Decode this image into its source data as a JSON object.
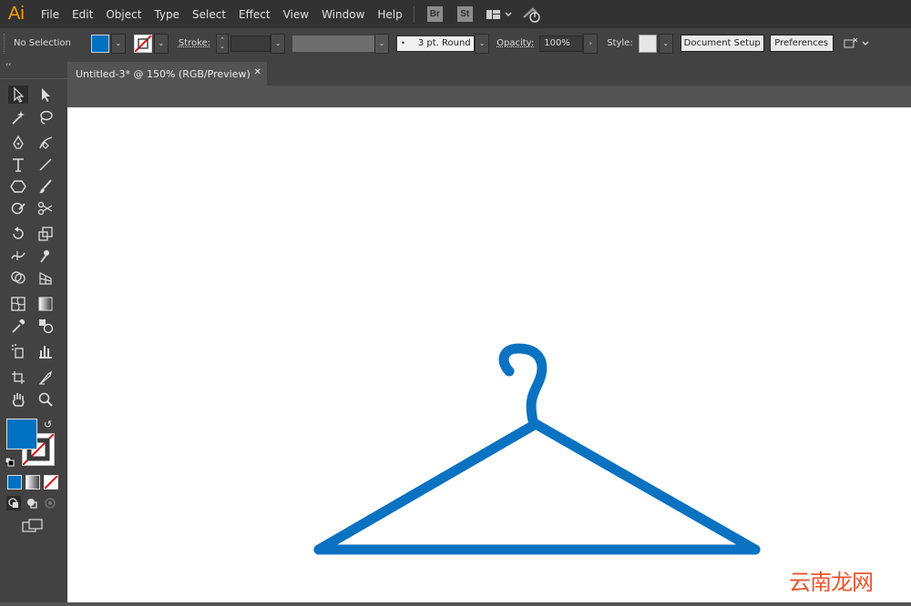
{
  "app": {
    "logo": "Ai"
  },
  "menu": [
    "File",
    "Edit",
    "Object",
    "Type",
    "Select",
    "Effect",
    "View",
    "Window",
    "Help"
  ],
  "bridge": {
    "br": "Br",
    "st": "St"
  },
  "control_bar": {
    "selection_status": "No Selection",
    "fill_color": "#0070c0",
    "stroke_label": "Stroke:",
    "brush_value": "3 pt. Round",
    "opacity_label": "Opacity:",
    "opacity_value": "100%",
    "style_label": "Style:",
    "document_setup": "Document Setup",
    "preferences": "Preferences"
  },
  "document": {
    "tab_title": "Untitled-3* @ 150% (RGB/Preview)",
    "close": "✕"
  },
  "artwork": {
    "object": "hanger",
    "stroke_color": "#0a72c1"
  },
  "watermark": "云南龙网",
  "colors": {
    "menubar": "#323232",
    "controlbar": "#424242",
    "panel": "#424242",
    "workspace": "#535353",
    "accent": "#0070c0",
    "logo": "#ff9a00"
  }
}
